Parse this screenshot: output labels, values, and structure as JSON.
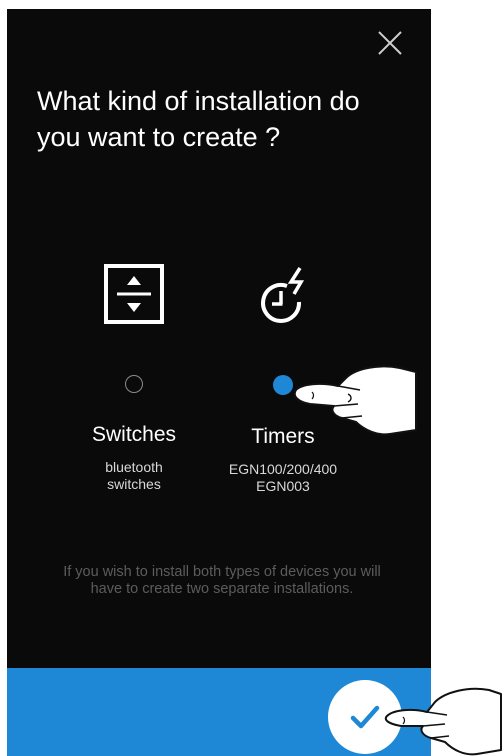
{
  "dialog": {
    "title": "What kind of installation do you want to create ?",
    "close_icon": "close-icon"
  },
  "options": [
    {
      "label": "Switches",
      "sub_lines": [
        "bluetooth",
        "switches"
      ],
      "icon": "up-down-arrows-icon",
      "selected": false
    },
    {
      "label": "Timers",
      "sub_lines": [
        "EGN100/200/400",
        "EGN003"
      ],
      "icon": "timer-lightning-icon",
      "selected": true
    }
  ],
  "note": "If you wish to install both types of devices you will have to create two separate installations.",
  "confirm_icon": "checkmark-icon",
  "colors": {
    "background": "#0a0a0a",
    "accent": "#1e88d6",
    "text": "#ffffff",
    "note_text": "#5c5c5c"
  }
}
